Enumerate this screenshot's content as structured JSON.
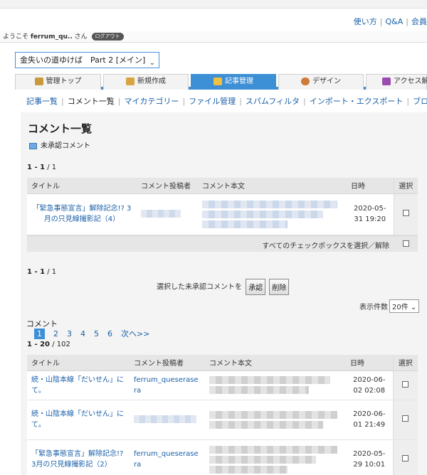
{
  "toplinks": {
    "help": "使い方",
    "qa": "Q&A",
    "member": "会員"
  },
  "welcome": {
    "prefix": "ようこそ",
    "user": "ferrum_qu..",
    "suffix": "さん",
    "logout": "ログアウト"
  },
  "blog_select": {
    "value": "金失いの道ゆけば　Part 2 [メイン]"
  },
  "tabs": [
    {
      "label": "管理トップ",
      "icon": "house-icon",
      "color": "#c89a3c"
    },
    {
      "label": "新規作成",
      "icon": "pencil-icon",
      "color": "#d8a440"
    },
    {
      "label": "記事管理",
      "icon": "document-icon",
      "color": "#f0c040"
    },
    {
      "label": "デザイン",
      "icon": "palette-icon",
      "color": "#d07a3a"
    },
    {
      "label": "アクセス解",
      "icon": "bar-chart-icon",
      "color": "#9a4ab0"
    }
  ],
  "subnav": [
    "記事一覧",
    "コメント一覧",
    "マイカテゴリー",
    "ファイル管理",
    "スパムフィルタ",
    "インポート・エクスポート",
    "ブログ"
  ],
  "page_title": "コメント一覧",
  "pending_label": "未承認コメント",
  "pending": {
    "count_range": "1 - 1",
    "count_total": "/ 1",
    "headers": {
      "title": "タイトル",
      "author": "コメント投稿者",
      "body": "コメント本文",
      "date": "日時",
      "select": "選択"
    },
    "rows": [
      {
        "title": "「緊急事態宣言」解除記念!? 3月の只見線撮影記（4）",
        "date": "2020-05-31 19:20"
      }
    ],
    "select_all_label": "すべてのチェックボックスを選択／解除",
    "count2_range": "1 - 1",
    "count2_total": "/ 1",
    "action_label": "選択した未承認コメントを",
    "approve_button": "承認",
    "delete_button": "削除"
  },
  "per_page": {
    "label": "表示件数",
    "value": "20件"
  },
  "comments": {
    "section_label": "コメント",
    "pages": [
      "1",
      "2",
      "3",
      "4",
      "5",
      "6"
    ],
    "next": "次へ>>",
    "count_range": "1 - 20",
    "count_total": "/ 102",
    "headers": {
      "title": "タイトル",
      "author": "コメント投稿者",
      "body": "コメント本文",
      "date": "日時",
      "select": "選択"
    },
    "rows": [
      {
        "title": "続・山陰本線「だいせん」にて。",
        "author": "ferrum_queserasera",
        "date": "2020-06-02 02:08"
      },
      {
        "title": "続・山陰本線「だいせん」にて。",
        "author": "",
        "date": "2020-06-01 21:49"
      },
      {
        "title": "「緊急事態宣言」解除記念!? 3月の只見線撮影記（2）",
        "author": "ferrum_queserasera",
        "date": "2020-05-29 10:01"
      }
    ]
  }
}
